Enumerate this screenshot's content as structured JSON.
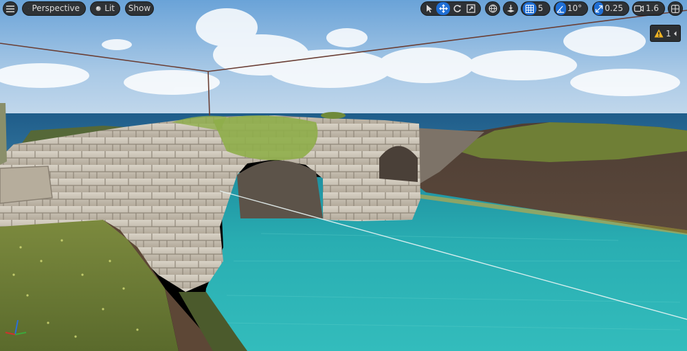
{
  "app": "Level Viewport",
  "toolbar": {
    "menu_icon": "hamburger-icon",
    "view_mode": {
      "label": "Perspective",
      "icon": "cube-icon"
    },
    "lighting": {
      "label": "Lit",
      "icon": "sphere-icon"
    },
    "show": {
      "label": "Show"
    },
    "transform_tools": [
      {
        "name": "select",
        "icon": "cursor-icon",
        "active": false
      },
      {
        "name": "translate",
        "icon": "move-icon",
        "active": true
      },
      {
        "name": "rotate",
        "icon": "rotate-icon",
        "active": false
      },
      {
        "name": "scale",
        "icon": "scale-icon",
        "active": false
      }
    ],
    "coordinate_space_icon": "world-icon",
    "surface_snapping_icon": "surface-snap-icon",
    "grid_snap": {
      "icon": "grid-icon",
      "value": "5",
      "active": true
    },
    "rotation_snap": {
      "icon": "angle-icon",
      "value": "10°",
      "active": true
    },
    "scale_snap": {
      "icon": "scale-snap-icon",
      "value": "0.25",
      "active": true
    },
    "camera_speed": {
      "icon": "camera-icon",
      "value": "1.6"
    },
    "layout_icon": "viewport-layout-icon"
  },
  "warning": {
    "icon": "warning-icon",
    "count": "1"
  },
  "colors": {
    "accent": "#1f6fd6",
    "toolbar_bg": "#282828",
    "warning": "#f0b323",
    "sky_top": "#6fa4d6",
    "water": "#2bb3b3"
  }
}
